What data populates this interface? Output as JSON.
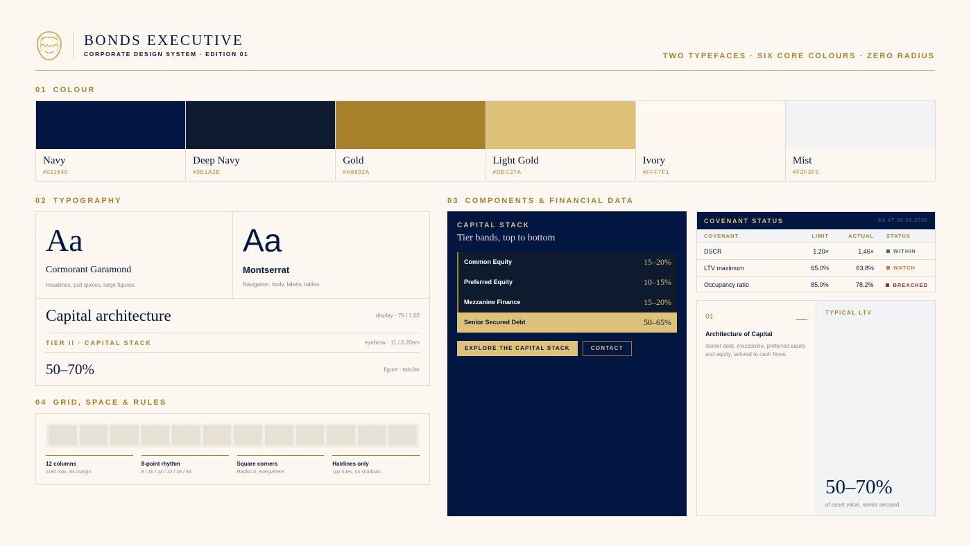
{
  "header": {
    "brand": "BONDS EXECUTIVE",
    "subtitle": "CORPORATE DESIGN SYSTEM · EDITION 01",
    "tagline": "TWO TYPEFACES · SIX CORE COLOURS · ZERO RADIUS",
    "logo_icon": "lion-head-icon"
  },
  "sections": {
    "colour": {
      "num": "01",
      "label": "COLOUR"
    },
    "typography": {
      "num": "02",
      "label": "TYPOGRAPHY"
    },
    "components": {
      "num": "03",
      "label": "COMPONENTS & FINANCIAL DATA"
    },
    "grid": {
      "num": "04",
      "label": "GRID, SPACE & RULES"
    }
  },
  "colours": [
    {
      "name": "Navy",
      "hex": "#011640"
    },
    {
      "name": "Deep Navy",
      "hex": "#0E1A2E"
    },
    {
      "name": "Gold",
      "hex": "#A8802A"
    },
    {
      "name": "Light Gold",
      "hex": "#DEC27A"
    },
    {
      "name": "Ivory",
      "hex": "#FFF7F1"
    },
    {
      "name": "Mist",
      "hex": "#F2F3F5"
    }
  ],
  "typography": {
    "serif": {
      "sample": "Aa",
      "name": "Cormorant Garamond",
      "desc": "Headlines, pull quotes, large figures."
    },
    "sans": {
      "sample": "Aa",
      "name": "Montserrat",
      "desc": "Navigation, body, labels, tables."
    },
    "rows": [
      {
        "text": "Capital architecture",
        "spec": "display · 76 / 1.02"
      },
      {
        "text": "TIER II · CAPITAL STACK",
        "spec": "eyebrow · 11 / 0.20em"
      },
      {
        "text": "50–70%",
        "spec": "figure · tabular"
      }
    ]
  },
  "grid": {
    "column_count": 12,
    "rules": [
      {
        "title": "12 columns",
        "desc": "1180 max, 64 margin"
      },
      {
        "title": "8-point rhythm",
        "desc": "8 / 16 / 24 / 32 / 48 / 64"
      },
      {
        "title": "Square corners",
        "desc": "Radius 0, everywhere"
      },
      {
        "title": "Hairlines only",
        "desc": "1px rules, no shadows"
      }
    ]
  },
  "capital_stack": {
    "eyebrow": "CAPITAL STACK",
    "subtitle": "Tier bands, top to bottom",
    "bands": [
      {
        "name": "Common Equity",
        "range": "15–20%"
      },
      {
        "name": "Preferred Equity",
        "range": "10–15%"
      },
      {
        "name": "Mezzanine Finance",
        "range": "15–20%"
      },
      {
        "name": "Senior Secured Debt",
        "range": "50–65%"
      }
    ],
    "primary_button": "EXPLORE THE CAPITAL STACK",
    "secondary_button": "CONTACT"
  },
  "covenant": {
    "title": "COVENANT STATUS",
    "as_at": "AS AT 30.06.2026",
    "columns": [
      "COVENANT",
      "LIMIT",
      "ACTUAL",
      "STATUS"
    ],
    "rows": [
      {
        "covenant": "DSCR",
        "limit": "1.20×",
        "actual": "1.46×",
        "status": "WITHIN",
        "color": "#2E7D4F"
      },
      {
        "covenant": "LTV maximum",
        "limit": "65.0%",
        "actual": "63.8%",
        "status": "WATCH",
        "color": "#D9772B"
      },
      {
        "covenant": "Occupancy ratio",
        "limit": "85.0%",
        "actual": "78.2%",
        "status": "BREACHED",
        "color": "#9B2C2C"
      }
    ]
  },
  "architecture": {
    "num": "01",
    "title": "Architecture of Capital",
    "desc": "Senior debt, mezzanine, preferred equity and equity, tailored to cash flows.",
    "ltv_label": "TYPICAL LTV",
    "ltv_figure": "50–70%",
    "ltv_note": "of asset value, senior secured"
  }
}
